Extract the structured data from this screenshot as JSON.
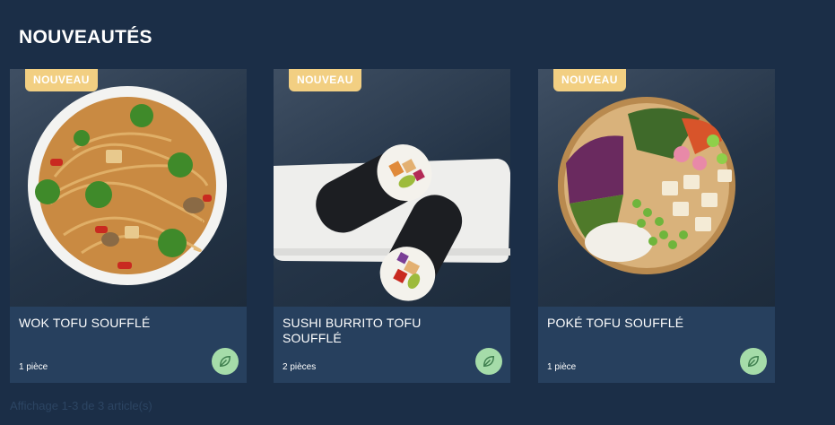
{
  "section": {
    "title": "NOUVEAUTÉS"
  },
  "products": [
    {
      "badge": "NOUVEAU",
      "name": "WOK TOFU SOUFFLÉ",
      "qty": "1 pièce",
      "diet_icon": "leaf-icon"
    },
    {
      "badge": "NOUVEAU",
      "name": "SUSHI BURRITO TOFU SOUFFLÉ",
      "qty": "2 pièces",
      "diet_icon": "leaf-icon"
    },
    {
      "badge": "NOUVEAU",
      "name": "POKÉ TOFU SOUFFLÉ",
      "qty": "1 pièce",
      "diet_icon": "leaf-icon"
    }
  ],
  "footer": {
    "note": "Affichage 1-3 de 3 article(s)"
  },
  "colors": {
    "background": "#1b2e47",
    "card": "#27405e",
    "badge": "#f2cf82",
    "veg_icon": "#a5dca9"
  }
}
